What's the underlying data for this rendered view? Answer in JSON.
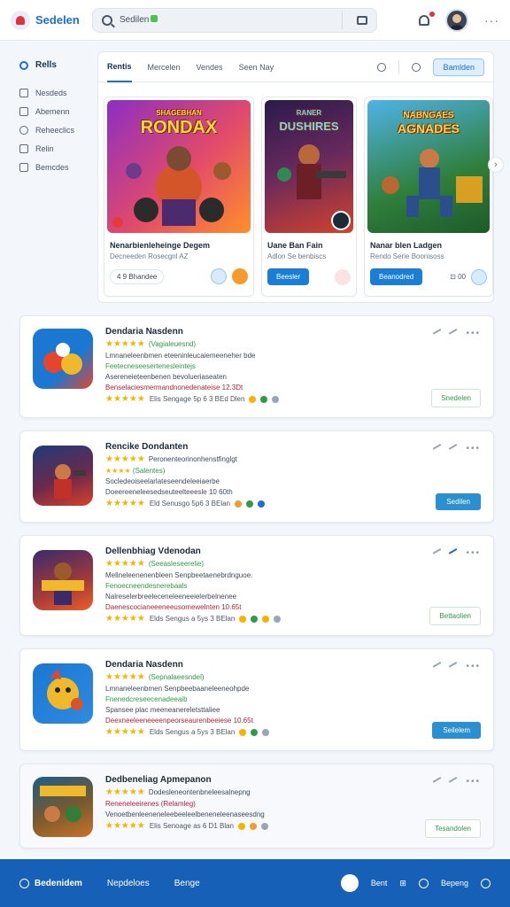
{
  "app": {
    "title": "Sedelen"
  },
  "search": {
    "value": "Sedilen"
  },
  "sidebar": {
    "active": "Rells",
    "items": [
      "Nesdeds",
      "Abemenn",
      "Reheeclics",
      "Relin",
      "Bemcdes"
    ]
  },
  "tabs": {
    "items": [
      "Rentis",
      "Mercelen",
      "Vendes",
      "Seen Nay"
    ],
    "button": "Bamlden"
  },
  "featured": [
    {
      "art_title": "RONDAX",
      "art_kicker": "SHAGEBHAN",
      "name": "Nenarbienleheinge Degem",
      "sub": "Decneeden Rosecgnl AZ",
      "pill": "Bhandee",
      "colors": [
        "#8d2ec4",
        "#ff8f2a"
      ]
    },
    {
      "art_title": "DUSHIRES",
      "art_kicker": "RANER",
      "name": "Uane Ban Fain",
      "sub": "Adlon Se benbiscs",
      "button": "Beesler",
      "colors": [
        "#2a1a4c",
        "#d4422a"
      ]
    },
    {
      "art_title": "AGNADES",
      "art_kicker": "NABNGAES",
      "name": "Nanar blen Ladgen",
      "sub": "Rendo Serie Boonisoss",
      "button": "Beanodred",
      "colors": [
        "#2f7f3b",
        "#4fb3e8"
      ]
    }
  ],
  "list": [
    {
      "title": "Dendaria Nasdenn",
      "rating_text": "(Vagialeuesnd)",
      "line1": "Lmnaneleenbmen eteeninleucaiemeeneher bde",
      "line2": "Feetecneseesertenesleintejs",
      "line3": "Asereneieteenbenen bevolueriaseaten",
      "line4": "Benselaciesmermandnonedenateise 12.3Dt",
      "meta": "Elis  Sengage 5p 6 3 BEd Dlen",
      "button": "Snedelen",
      "btn_style": "ghost",
      "colors": [
        "#1a78d2",
        "#e6452d"
      ]
    },
    {
      "title": "Rencike Dondanten",
      "rating_text": "Peronenteorinonhenstfinglgt",
      "line1": "(Salentes)",
      "line2": "Socledeoiseelarlateseendeleeiaerbe",
      "line3": "Doeereeneleesedseuteelteeesle 10 60th",
      "line4": "",
      "meta": "Eld  Senusgo 5p6 3 BElan",
      "button": "Sedilen",
      "btn_style": "blue",
      "colors": [
        "#1f3b7a",
        "#d9402a"
      ]
    },
    {
      "title": "Dellenbhiag Vdenodan",
      "rating_text": "(Seeasleseerelie)",
      "line1": "Mellneleenenenbleen Senpbeetaenebrdnguoe.",
      "line2": "Fenoecneendesnerebaals",
      "line3": "Nalreselerbreeleceneleeneeielerbelnenee",
      "line4": "Daenescocianeeeneeusomewelnten 10.65t",
      "meta": "Elds  Sengus a 5ys 3 BElan",
      "button": "Bettaolien",
      "btn_style": "ghost",
      "colors": [
        "#3a2a6b",
        "#ef5d27"
      ]
    },
    {
      "title": "Dendaria Nasdenn",
      "rating_text": "(Sepnalaeesndel)",
      "line1": "Lmnaneleenbmen Senpbeebaaneleeneohpde",
      "line2": "Fnenedcreseecenadeeaib",
      "line3": "Spansee plac meeneanereletsttaliee",
      "line4": "Deexneeleeneeeenpeorseaurenbeeiese 10.65t",
      "meta": "Elds  Sengus a 5ys 3 BElan",
      "button": "Seilelem",
      "btn_style": "blue",
      "colors": [
        "#1a78d2",
        "#f0b92b"
      ]
    },
    {
      "title": "Dedbeneliag Apmepanon",
      "rating_text": "Dodesleneontenbneleesalnepng",
      "line1": "Reneneleeirenes (Relamleg)",
      "line2": "Venoetbenleeneneleebeeleelbeneneleenaseesdng",
      "line3": "Bebeenhuiemneonseedneweoeelbnetsoge 66 NAth",
      "line4": "",
      "meta": "Elis  Senoage as 6 D1 Blan",
      "button": "Tesandolen",
      "btn_style": "ghost",
      "colors": [
        "#1b5c8a",
        "#c9722c"
      ]
    }
  ],
  "bottom": {
    "left": [
      "Bedenidem",
      "Nepdeloes",
      "Benge"
    ],
    "right": [
      "Bent",
      "Bepeng"
    ]
  },
  "colors": {
    "accent": "#1b6fd6",
    "bottom_bar": "#1760b8",
    "star": "#f5b400",
    "green": "#2f9a4a"
  }
}
